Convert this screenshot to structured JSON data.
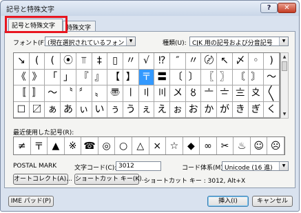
{
  "window": {
    "title": "記号と特殊文字",
    "help": "?",
    "close": "✕"
  },
  "tabs": [
    {
      "label": "記号と特殊文字"
    },
    {
      "label": "特殊文字"
    }
  ],
  "font": {
    "label": "フォント(F):",
    "value": "(現在選択されているフォント)"
  },
  "subset": {
    "label": "種類(U):",
    "value": "CJK 用の記号および分音記号"
  },
  "symbol_grid": [
    "↘",
    "(",
    "(",
    "⦿",
    "⫪",
    "‡",
    "▯",
    "〃",
    "√",
    "⁉",
    "″",
    "〃",
    "〄",
    "↖",
    "〆",
    "◦",
    ")",
    "《",
    "》",
    "「",
    "」",
    "『",
    "』",
    "【",
    "】",
    "〒",
    "〓",
    "〔",
    "〕",
    "〖",
    "〗",
    "〘",
    "〙",
    "〜",
    "〚",
    "〛",
    "〜",
    "〝",
    "〞",
    "〟",
    "〠",
    "〡",
    "〢",
    "〣",
    "〤",
    "〥",
    "〦",
    "〧",
    "〨",
    "〩",
    "〱",
    "☐",
    "〼",
    "ぁ",
    "あ",
    "ぃ",
    "い",
    "ぅ",
    "う",
    "ぇ",
    "え",
    "ぉ",
    "お",
    "か",
    "が",
    "き",
    "ぎ",
    "く"
  ],
  "selected_symbol": "〒",
  "recent": {
    "label": "最近使用した記号(R):",
    "symbols": [
      "≠",
      "〒",
      "▲",
      "※",
      "☎",
      "◎",
      "○",
      "△",
      "×",
      "☆",
      "◆",
      "∞",
      "✂",
      "♨",
      "☺",
      "☹"
    ]
  },
  "char_name": "POSTAL MARK",
  "char_code": {
    "label": "文字コード(C):",
    "value": "3012"
  },
  "encoding": {
    "label": "コード体系(M):",
    "value": "Unicode (16 進)"
  },
  "autocorrect_button": "オートコレクト(A)...",
  "shortcut_button": "ショートカット キー(K)...",
  "shortcut_text": "ショートカット キー : 3012, Alt+X",
  "ime_button": "IME パッド(P)",
  "insert_button": "挿入(I)",
  "cancel_button": "キャンセル"
}
